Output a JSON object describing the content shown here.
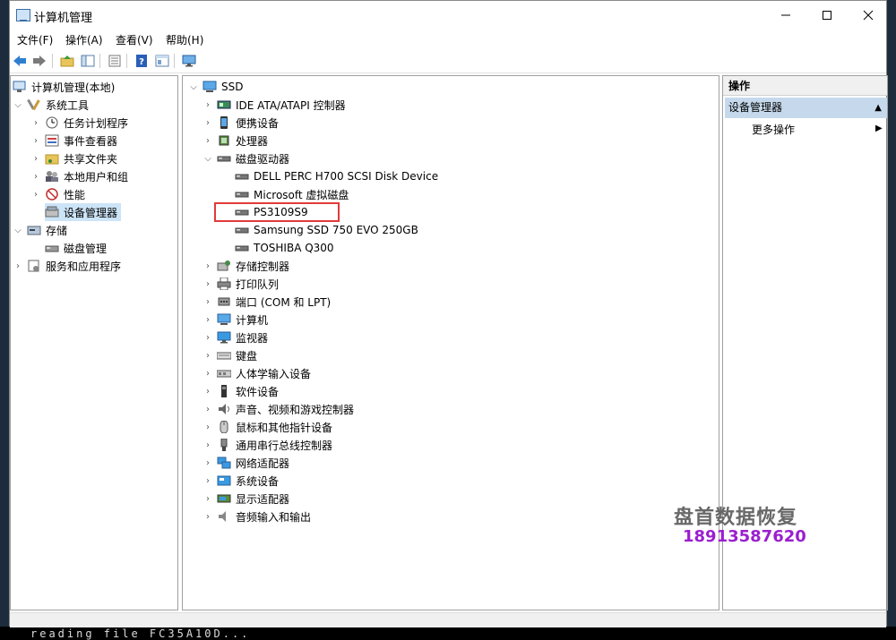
{
  "window": {
    "title": "计算机管理"
  },
  "menu": [
    "文件(F)",
    "操作(A)",
    "查看(V)",
    "帮助(H)"
  ],
  "toolbar": {
    "icons": [
      "back-icon",
      "forward-icon",
      "up-folder-icon",
      "show-tree-icon",
      "export-icon",
      "help-icon",
      "view-icon",
      "monitor-icon"
    ]
  },
  "left_tree": {
    "root": "计算机管理(本地)",
    "system_tools": "系统工具",
    "task_scheduler": "任务计划程序",
    "event_viewer": "事件查看器",
    "shared_folders": "共享文件夹",
    "local_users": "本地用户和组",
    "performance": "性能",
    "device_manager": "设备管理器",
    "storage": "存储",
    "disk_management": "磁盘管理",
    "services_apps": "服务和应用程序"
  },
  "device_tree": {
    "root": "SSD",
    "categories_before": [
      {
        "label": "IDE ATA/ATAPI 控制器",
        "icon": "ide-controller-icon"
      },
      {
        "label": "便携设备",
        "icon": "portable-device-icon"
      },
      {
        "label": "处理器",
        "icon": "processor-icon"
      }
    ],
    "disk_drives": "磁盘驱动器",
    "disks": [
      "DELL PERC H700 SCSI Disk Device",
      "Microsoft 虚拟磁盘",
      "PS3109S9",
      "Samsung SSD 750 EVO 250GB",
      "TOSHIBA Q300"
    ],
    "categories_after": [
      {
        "label": "存储控制器",
        "icon": "storage-controller-icon"
      },
      {
        "label": "打印队列",
        "icon": "printer-icon"
      },
      {
        "label": "端口 (COM 和 LPT)",
        "icon": "port-icon"
      },
      {
        "label": "计算机",
        "icon": "computer-icon"
      },
      {
        "label": "监视器",
        "icon": "monitor-icon"
      },
      {
        "label": "键盘",
        "icon": "keyboard-icon"
      },
      {
        "label": "人体学输入设备",
        "icon": "hid-icon"
      },
      {
        "label": "软件设备",
        "icon": "software-device-icon"
      },
      {
        "label": "声音、视频和游戏控制器",
        "icon": "sound-icon"
      },
      {
        "label": "鼠标和其他指针设备",
        "icon": "mouse-icon"
      },
      {
        "label": "通用串行总线控制器",
        "icon": "usb-icon"
      },
      {
        "label": "网络适配器",
        "icon": "network-icon"
      },
      {
        "label": "系统设备",
        "icon": "system-device-icon"
      },
      {
        "label": "显示适配器",
        "icon": "display-adapter-icon"
      },
      {
        "label": "音频输入和输出",
        "icon": "audio-icon"
      }
    ]
  },
  "actions": {
    "header": "操作",
    "group": "设备管理器",
    "more": "更多操作"
  },
  "watermark": {
    "name": "盘首数据恢复",
    "phone": "18913587620"
  },
  "background_console": "reading file FC35A10D..."
}
